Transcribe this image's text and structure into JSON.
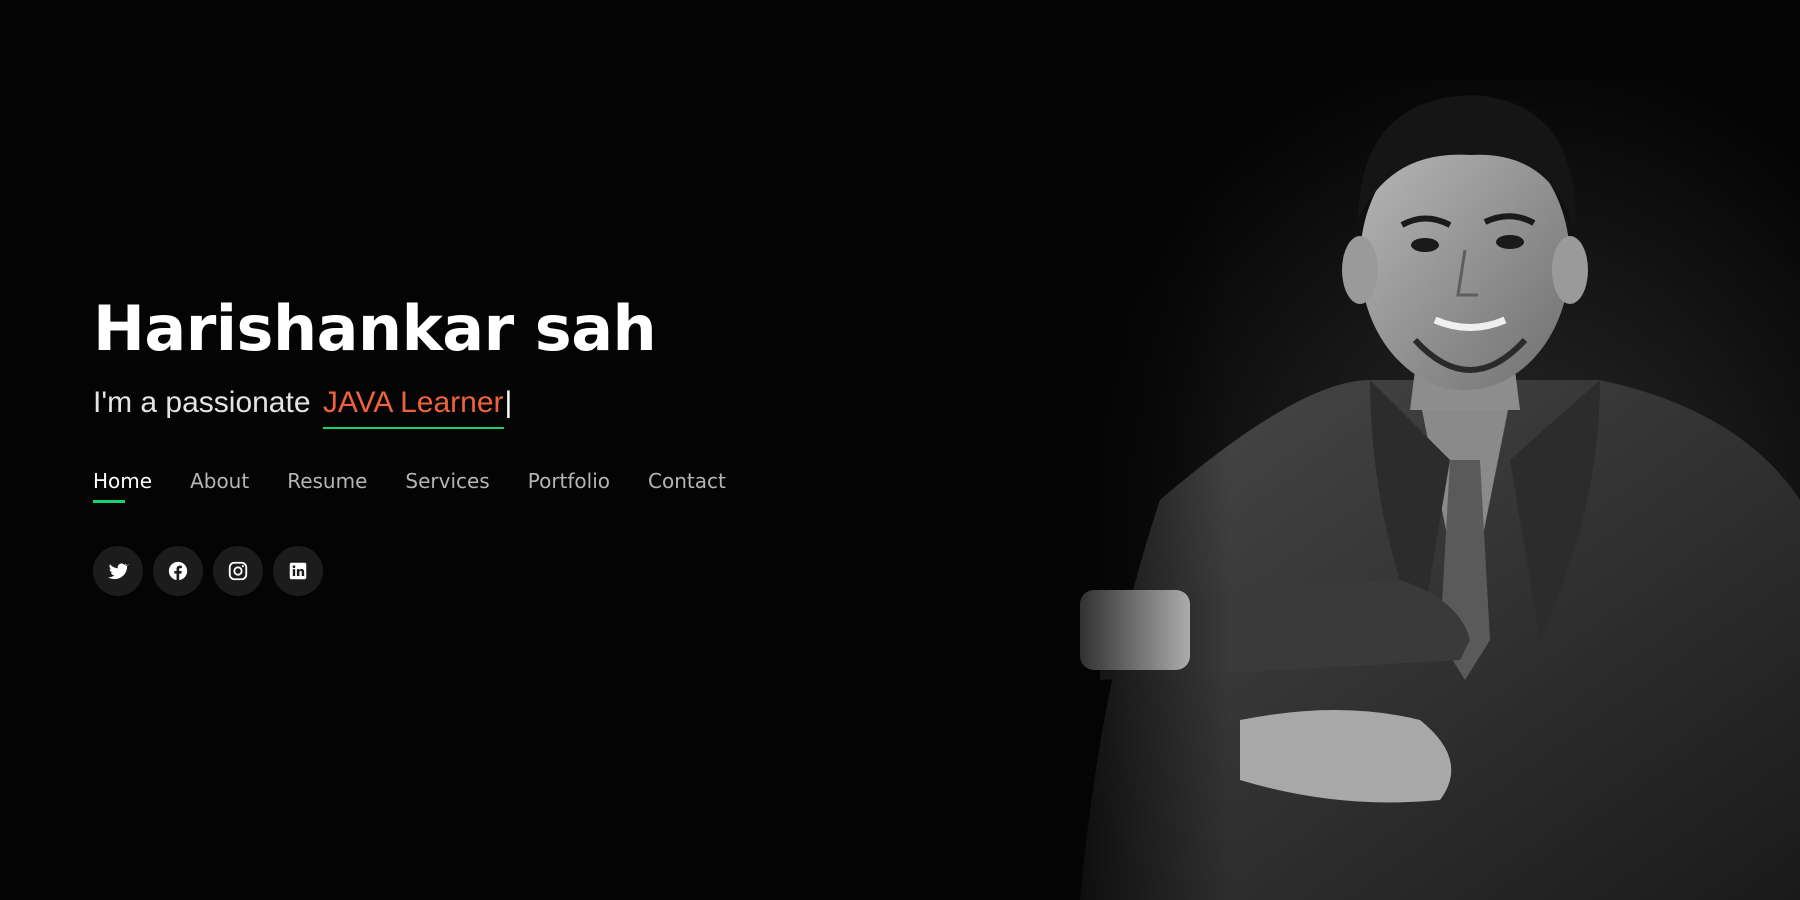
{
  "hero": {
    "name": "Harishankar sah",
    "tagline_prefix": "I'm a passionate",
    "typed_text": "JAVA Learner",
    "caret": "|"
  },
  "nav": {
    "items": [
      {
        "label": "Home",
        "active": true
      },
      {
        "label": "About",
        "active": false
      },
      {
        "label": "Resume",
        "active": false
      },
      {
        "label": "Services",
        "active": false
      },
      {
        "label": "Portfolio",
        "active": false
      },
      {
        "label": "Contact",
        "active": false
      }
    ]
  },
  "social": [
    {
      "icon": "twitter-icon"
    },
    {
      "icon": "facebook-icon"
    },
    {
      "icon": "instagram-icon"
    },
    {
      "icon": "linkedin-icon"
    }
  ],
  "colors": {
    "background": "#040404",
    "accent_underline": "#18d26e",
    "typed_text": "#f0623a",
    "nav_inactive": "#b5b5b5",
    "social_button_bg": "#1c1c1c"
  }
}
